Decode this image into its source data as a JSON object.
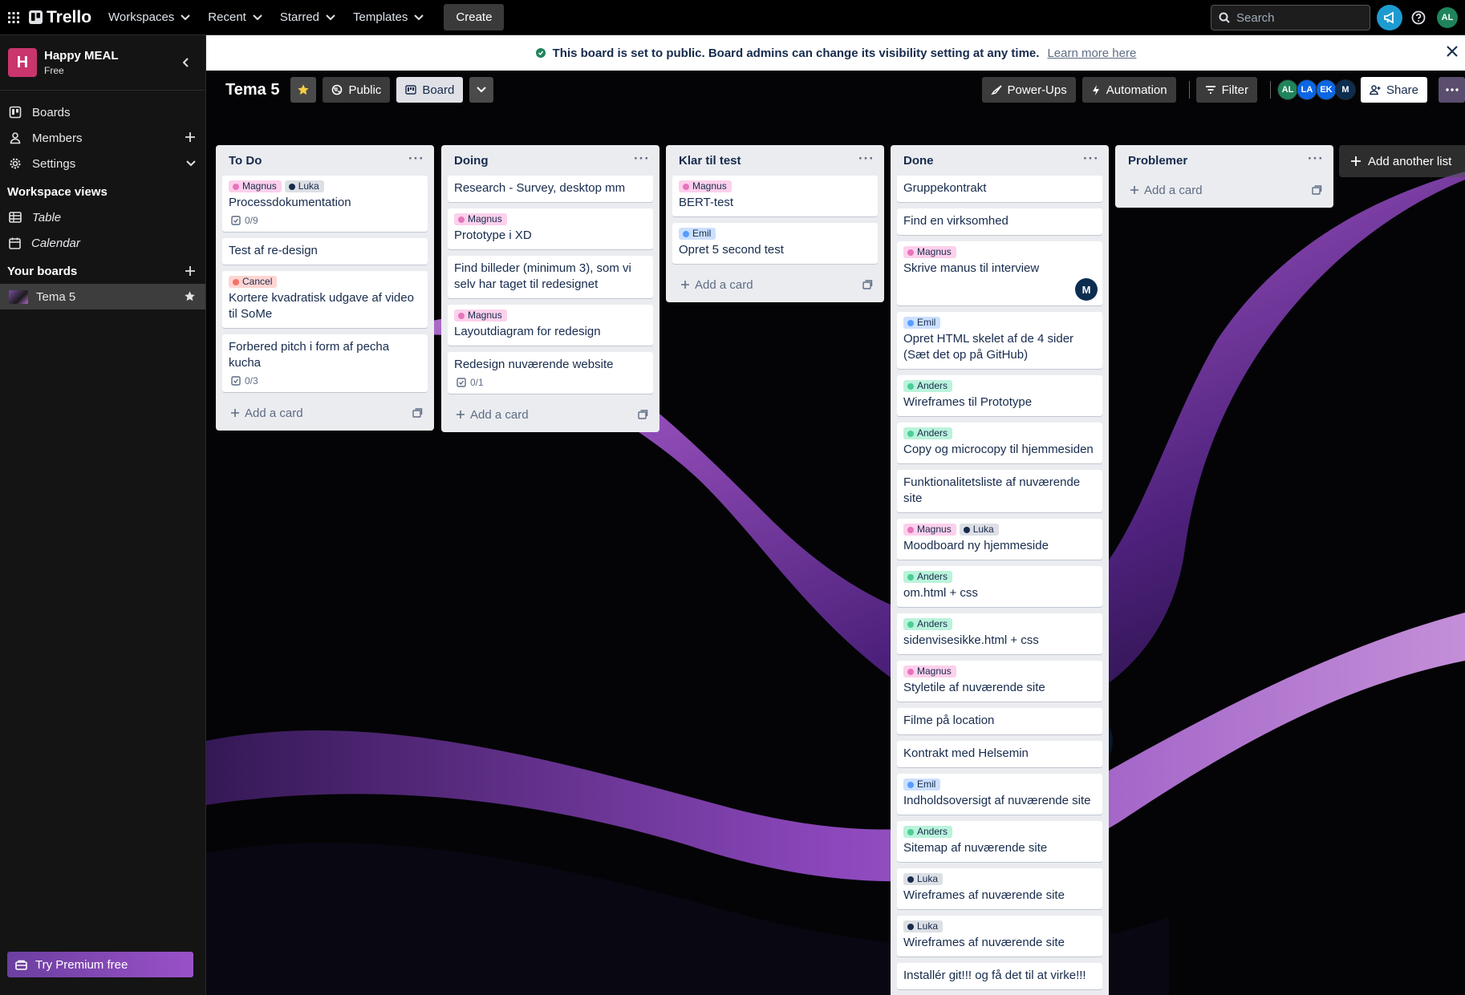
{
  "topnav": {
    "logo": "Trello",
    "menus": [
      "Workspaces",
      "Recent",
      "Starred",
      "Templates"
    ],
    "create": "Create",
    "search_placeholder": "Search",
    "user_initials": "AL"
  },
  "sidebar": {
    "workspace_initial": "H",
    "workspace_name": "Happy MEAL",
    "workspace_plan": "Free",
    "items": [
      {
        "label": "Boards"
      },
      {
        "label": "Members"
      },
      {
        "label": "Settings"
      }
    ],
    "views_heading": "Workspace views",
    "views": [
      {
        "label": "Table"
      },
      {
        "label": "Calendar"
      }
    ],
    "boards_heading": "Your boards",
    "boards": [
      {
        "label": "Tema 5"
      }
    ],
    "premium": "Try Premium free"
  },
  "banner": {
    "text": "This board is set to public. Board admins can change its visibility setting at any time.",
    "link": "Learn more here"
  },
  "board": {
    "title": "Tema 5",
    "visibility": "Public",
    "view": "Board",
    "powerups": "Power-Ups",
    "automation": "Automation",
    "filter": "Filter",
    "members": [
      {
        "initials": "AL",
        "color": "#1f845a"
      },
      {
        "initials": "LA",
        "color": "#0c66e4"
      },
      {
        "initials": "EK",
        "color": "#0c66e4"
      },
      {
        "initials": "M",
        "color": "#0c2d50"
      }
    ],
    "share": "Share",
    "add_list": "Add another list",
    "add_card": "Add a card"
  },
  "label_colors": {
    "Magnus": {
      "bg": "#fdd0ec",
      "dot": "#e774bb"
    },
    "Luka": {
      "bg": "#dcdfe4",
      "dot": "#172b4d"
    },
    "Cancel": {
      "bg": "#ffd5d2",
      "dot": "#f87168"
    },
    "Emil": {
      "bg": "#cce0ff",
      "dot": "#579dff"
    },
    "Anders": {
      "bg": "#baf3db",
      "dot": "#4bce97"
    }
  },
  "lists": [
    {
      "title": "To Do",
      "cards": [
        {
          "labels": [
            "Magnus",
            "Luka"
          ],
          "title": "Processdokumentation",
          "checklist": "0/9"
        },
        {
          "labels": [],
          "title": "Test af re-design"
        },
        {
          "labels": [
            "Cancel"
          ],
          "title": "Kortere kvadratisk udgave af video til SoMe"
        },
        {
          "labels": [],
          "title": "Forbered pitch i form af pecha kucha",
          "checklist": "0/3"
        }
      ]
    },
    {
      "title": "Doing",
      "cards": [
        {
          "labels": [],
          "title": "Research - Survey, desktop mm"
        },
        {
          "labels": [
            "Magnus"
          ],
          "title": "Prototype i XD"
        },
        {
          "labels": [],
          "title": "Find billeder (minimum 3), som vi selv har taget til redesignet"
        },
        {
          "labels": [
            "Magnus"
          ],
          "title": "Layoutdiagram for redesign"
        },
        {
          "labels": [],
          "title": "Redesign nuværende website",
          "checklist": "0/1"
        }
      ]
    },
    {
      "title": "Klar til test",
      "cards": [
        {
          "labels": [
            "Magnus"
          ],
          "title": "BERT-test"
        },
        {
          "labels": [
            "Emil"
          ],
          "title": "Opret 5 second test"
        }
      ]
    },
    {
      "title": "Done",
      "cards": [
        {
          "labels": [],
          "title": "Gruppekontrakt"
        },
        {
          "labels": [],
          "title": "Find en virksomhed"
        },
        {
          "labels": [
            "Magnus"
          ],
          "title": "Skrive manus til interview",
          "member": "M"
        },
        {
          "labels": [
            "Emil"
          ],
          "title": "Opret HTML skelet af de 4 sider (Sæt det op på GitHub)"
        },
        {
          "labels": [
            "Anders"
          ],
          "title": "Wireframes til Prototype"
        },
        {
          "labels": [
            "Anders"
          ],
          "title": "Copy og microcopy til hjemmesiden"
        },
        {
          "labels": [],
          "title": "Funktionalitetsliste af nuværende site"
        },
        {
          "labels": [
            "Magnus",
            "Luka"
          ],
          "title": "Moodboard ny hjemmeside"
        },
        {
          "labels": [
            "Anders"
          ],
          "title": "om.html + css"
        },
        {
          "labels": [
            "Anders"
          ],
          "title": "sidenvisesikke.html + css"
        },
        {
          "labels": [
            "Magnus"
          ],
          "title": "Styletile af nuværende site"
        },
        {
          "labels": [],
          "title": "Filme på location"
        },
        {
          "labels": [],
          "title": "Kontrakt med Helsemin"
        },
        {
          "labels": [
            "Emil"
          ],
          "title": "Indholdsoversigt af nuværende site"
        },
        {
          "labels": [
            "Anders"
          ],
          "title": "Sitemap af nuværende site"
        },
        {
          "labels": [
            "Luka"
          ],
          "title": "Wireframes af nuværende site"
        },
        {
          "labels": [
            "Luka"
          ],
          "title": "Wireframes af nuværende site"
        },
        {
          "labels": [],
          "title": "Installér git!!! og få det til at virke!!!"
        }
      ]
    },
    {
      "title": "Problemer",
      "cards": []
    }
  ]
}
